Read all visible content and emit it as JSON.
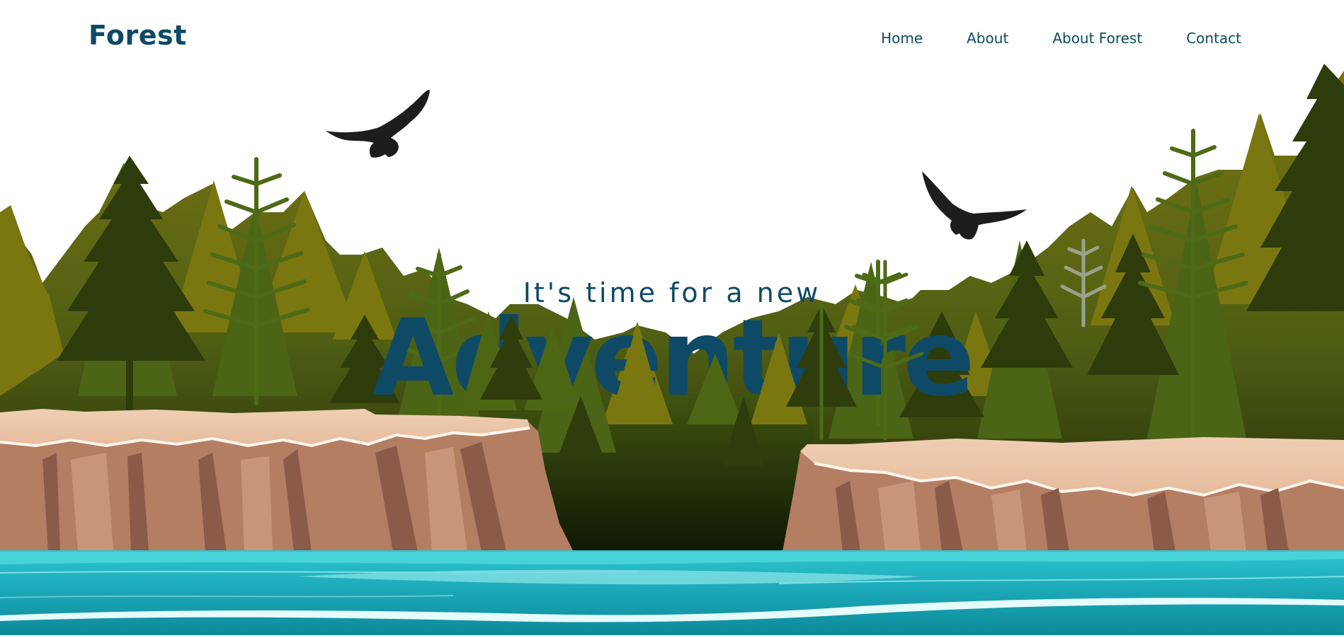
{
  "brand": {
    "logo": "Forest"
  },
  "nav": {
    "items": [
      {
        "label": "Home"
      },
      {
        "label": "About"
      },
      {
        "label": "About Forest"
      },
      {
        "label": "Contact"
      }
    ]
  },
  "hero": {
    "tagline": "It's time for a new",
    "headline": "Adventure"
  },
  "colors": {
    "brand": "#0d4a66",
    "water": "#1fa9b8",
    "cliff_top": "#ecc6a8",
    "cliff_face": "#b98468",
    "tree_dark": "#2f3c0c",
    "tree_olive": "#75730f"
  },
  "decor": [
    "eagle-silhouette",
    "eagle-silhouette",
    "pine-forest",
    "cliffs",
    "river"
  ]
}
